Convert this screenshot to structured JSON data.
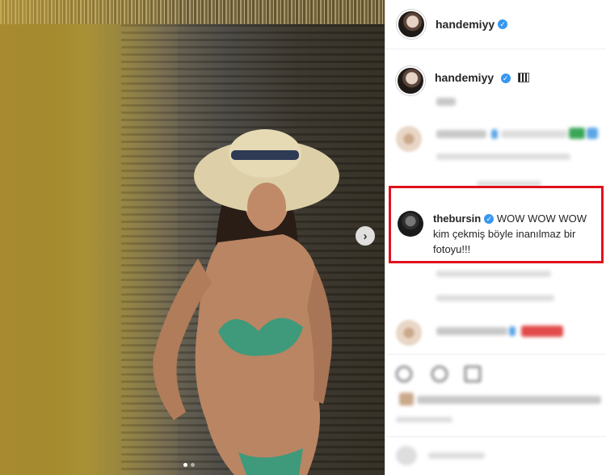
{
  "post": {
    "author": "handemiyy",
    "slide_count": 2,
    "active_slide": 1,
    "next_icon": "chevron-right-icon"
  },
  "caption": {
    "username": "handemiyy",
    "flag_icon": "flag-icon"
  },
  "highlighted_comment": {
    "username": "thebursin",
    "text": "WOW WOW WOW kim çekmiş böyle inanılmaz bir fotoyu!!!"
  },
  "colors": {
    "verified": "#3897f0",
    "highlight_border": "#e0121e"
  }
}
